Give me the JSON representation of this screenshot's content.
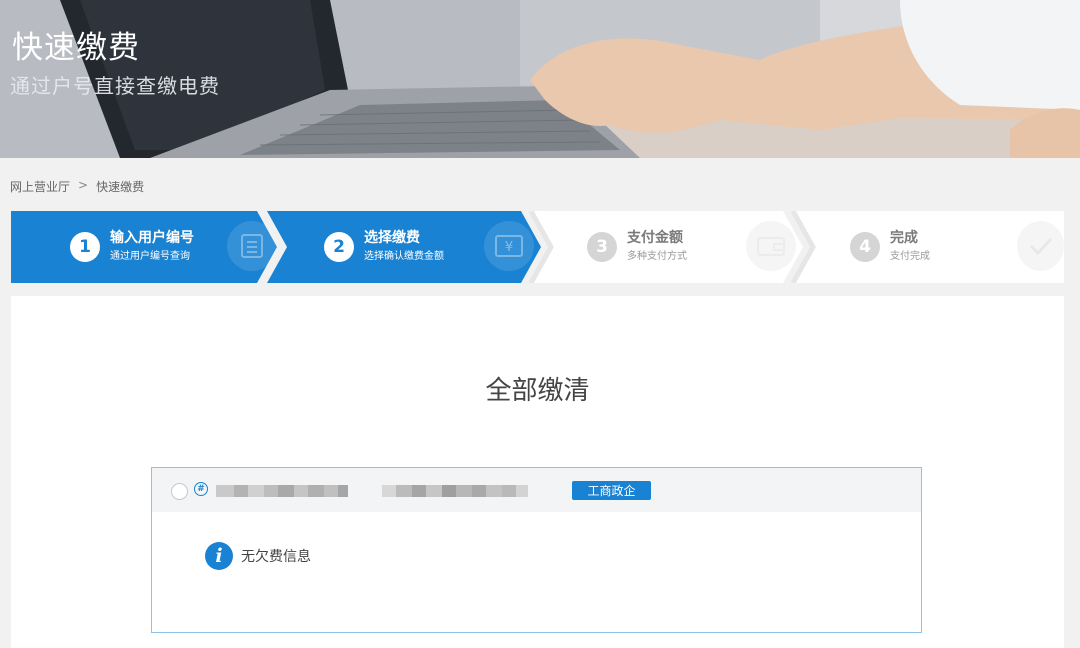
{
  "banner": {
    "title": "快速缴费",
    "subtitle": "通过户号直接查缴电费"
  },
  "breadcrumb": {
    "home": "网上营业厅",
    "separator": ">",
    "current": "快速缴费"
  },
  "steps": [
    {
      "number": "1",
      "title": "输入用户编号",
      "subtitle": "通过用户编号查询",
      "state": "active",
      "icon": "list-icon"
    },
    {
      "number": "2",
      "title": "选择缴费",
      "subtitle": "选择确认缴费金额",
      "state": "active",
      "icon": "yen-icon"
    },
    {
      "number": "3",
      "title": "支付金额",
      "subtitle": "多种支付方式",
      "state": "inactive",
      "icon": "wallet-icon"
    },
    {
      "number": "4",
      "title": "完成",
      "subtitle": "支付完成",
      "state": "inactive",
      "icon": "check-icon"
    }
  ],
  "main": {
    "title": "全部缴清",
    "account": {
      "hash_symbol": "#",
      "badge": "工商政企",
      "info_icon": "i",
      "info_text": "无欠费信息"
    }
  },
  "colors": {
    "accent": "#1a82d2",
    "inactive_step": "#ffffff",
    "page_bg": "#f1f1f1"
  }
}
